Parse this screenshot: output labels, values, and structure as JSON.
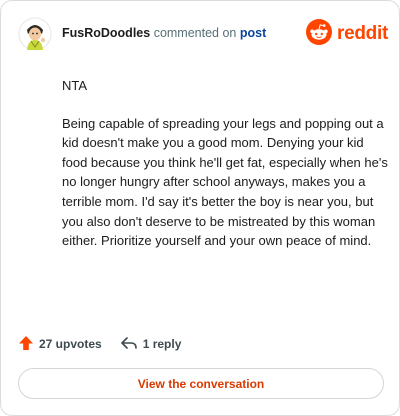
{
  "header": {
    "username": "FusRoDoodles",
    "action_text": "commented on",
    "target_text": "post",
    "brand_name": "reddit",
    "brand_color": "#ff4500"
  },
  "comment": {
    "paragraphs": [
      "NTA",
      "Being capable of spreading your legs and popping out a kid doesn't make you a good mom. Denying your kid food because you think he'll get fat, especially when he's no longer hungry after school anyways, makes you a terrible mom. I'd say it's better the boy is near you, but you also don't deserve to be mistreated by this woman either. Prioritize yourself and your own peace of mind."
    ]
  },
  "actions": {
    "upvotes_label": "27 upvotes",
    "replies_label": "1 reply",
    "upvote_icon": "arrow-up-icon",
    "reply_icon": "reply-icon"
  },
  "cta": {
    "label": "View the conversation"
  }
}
